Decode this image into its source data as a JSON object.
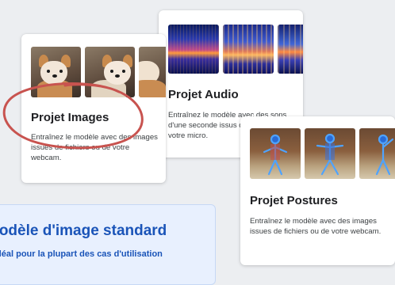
{
  "cards": {
    "images": {
      "title": "Projet Images",
      "description": "Entraînez le modèle avec des images issues de fichiers ou de votre webcam."
    },
    "audio": {
      "title": "Projet Audio",
      "description": "Entraînez le modèle avec des sons d'une seconde issus de fichiers ou de votre micro."
    },
    "postures": {
      "title": "Projet Postures",
      "description": "Entraînez le modèle avec des images issues de fichiers ou de votre webcam."
    }
  },
  "banner": {
    "title": "Modèle d'image standard",
    "subtitle": "Idéal pour la plupart des cas d'utilisation"
  },
  "colors": {
    "highlight_ring": "#c8534f",
    "banner_text": "#1a54b8",
    "banner_background": "#e8f0fe"
  }
}
